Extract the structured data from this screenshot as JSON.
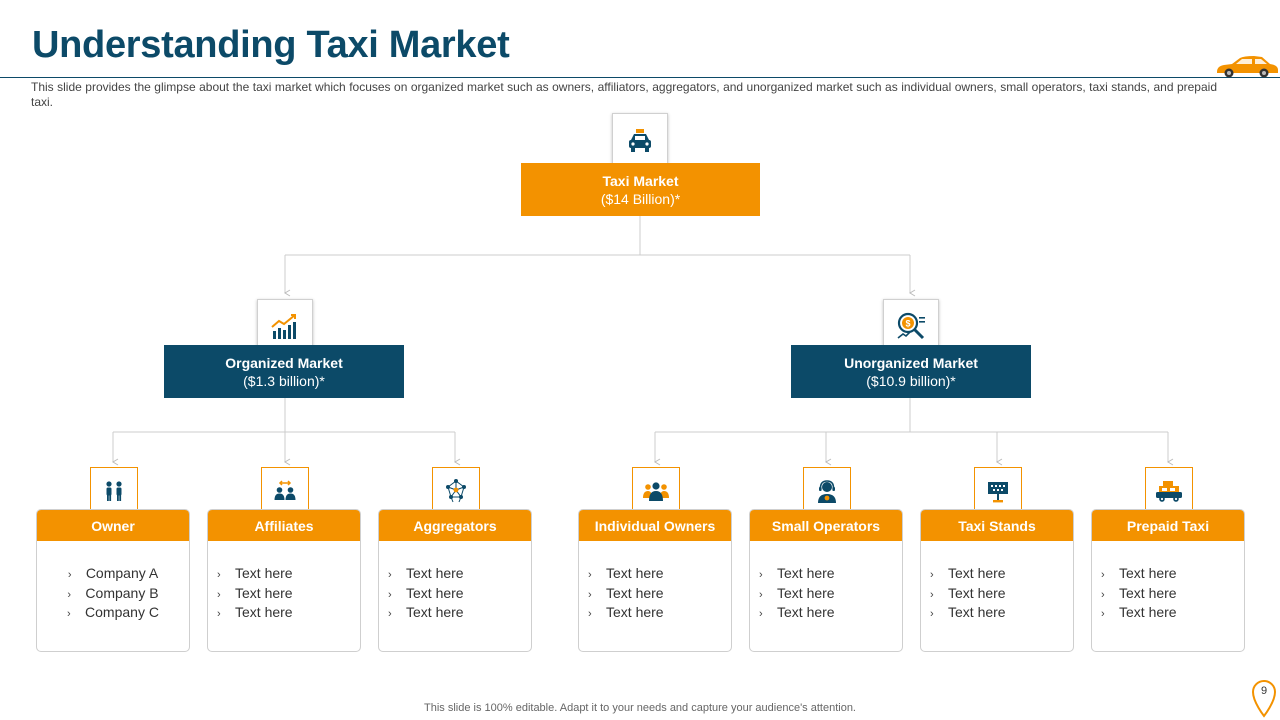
{
  "slide": {
    "title": "Understanding Taxi Market",
    "description": "This slide provides the glimpse about the taxi market which focuses on organized market such as owners, affiliators, aggregators, and unorganized market such as individual owners, small operators, taxi stands, and prepaid taxi.",
    "footer": "This slide is 100% editable. Adapt it to your needs and capture your audience's attention.",
    "page_number": "9"
  },
  "colors": {
    "navy": "#0c4a68",
    "orange": "#f39200",
    "connector": "#cccccc"
  },
  "root": {
    "title": "Taxi Market",
    "value": "($14 Billion)*",
    "icon": "taxi-icon"
  },
  "organized": {
    "title": "Organized Market",
    "value": "($1.3 billion)*",
    "icon": "growth-chart-icon"
  },
  "unorganized": {
    "title": "Unorganized Market",
    "value": "($10.9 billion)*",
    "icon": "money-search-icon"
  },
  "cards": [
    {
      "title": "Owner",
      "icon": "people-icon",
      "items": [
        "Company A",
        "Company B",
        "Company C"
      ]
    },
    {
      "title": "Affiliates",
      "icon": "partners-icon",
      "items": [
        "Text here",
        "Text here",
        "Text here"
      ]
    },
    {
      "title": "Aggregators",
      "icon": "network-icon",
      "items": [
        "Text here",
        "Text here",
        "Text here"
      ]
    },
    {
      "title": "Individual Owners",
      "icon": "group-icon",
      "items": [
        "Text here",
        "Text here",
        "Text here"
      ]
    },
    {
      "title": "Small Operators",
      "icon": "operator-icon",
      "items": [
        "Text here",
        "Text here",
        "Text here"
      ]
    },
    {
      "title": "Taxi Stands",
      "icon": "taxi-sign-icon",
      "items": [
        "Text here",
        "Text here",
        "Text here"
      ]
    },
    {
      "title": "Prepaid Taxi",
      "icon": "prepaid-taxi-icon",
      "items": [
        "Text here",
        "Text here",
        "Text here"
      ]
    }
  ]
}
